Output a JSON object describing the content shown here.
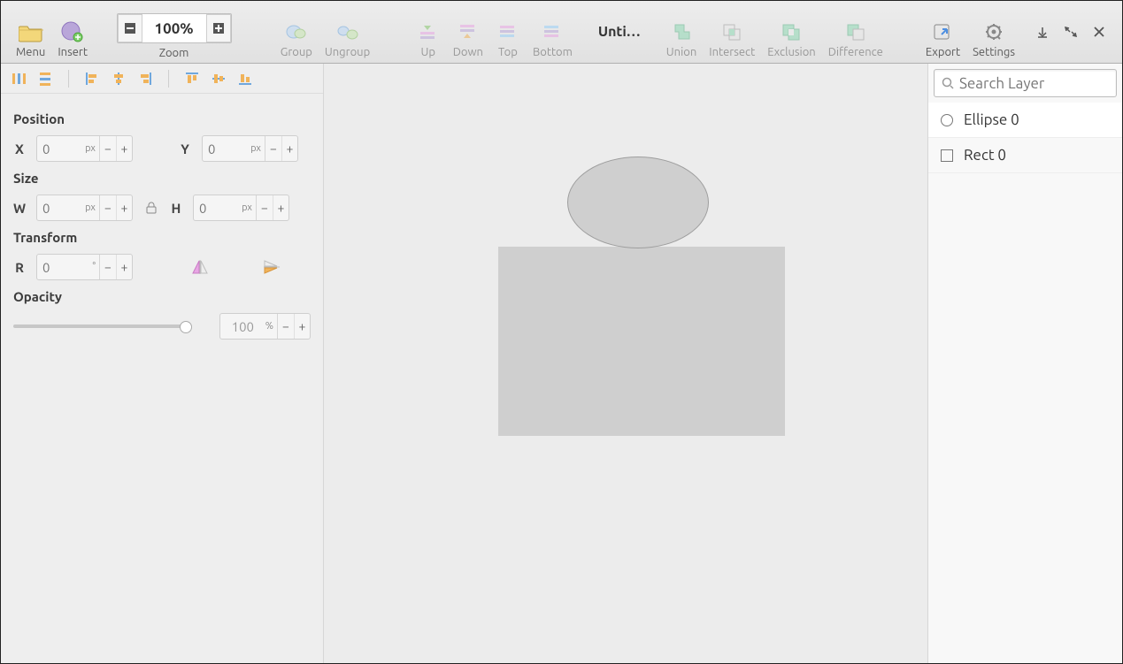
{
  "toolbar": {
    "menu": "Menu",
    "insert": "Insert",
    "zoom": {
      "label": "Zoom",
      "value": "100%"
    },
    "group": "Group",
    "ungroup": "Ungroup",
    "up": "Up",
    "down": "Down",
    "top": "Top",
    "bottom": "Bottom",
    "union": "Union",
    "intersect": "Intersect",
    "exclusion": "Exclusion",
    "difference": "Difference",
    "export": "Export",
    "settings": "Settings"
  },
  "document": {
    "title": "Unti…"
  },
  "props": {
    "position": {
      "label": "Position",
      "x_label": "X",
      "y_label": "Y",
      "x": "0",
      "y": "0",
      "unit": "px"
    },
    "size": {
      "label": "Size",
      "w_label": "W",
      "h_label": "H",
      "w": "0",
      "h": "0",
      "unit": "px"
    },
    "transform": {
      "label": "Transform",
      "r_label": "R",
      "r": "0",
      "unit": "°"
    },
    "opacity": {
      "label": "Opacity",
      "value": "100",
      "unit": "%"
    }
  },
  "layers": {
    "search_placeholder": "Search Layer",
    "items": [
      {
        "name": "Ellipse 0",
        "shape": "circle",
        "selected": true
      },
      {
        "name": "Rect 0",
        "shape": "rect",
        "selected": false
      }
    ]
  },
  "zoom_steps": {
    "minus": "−",
    "plus": "+"
  }
}
